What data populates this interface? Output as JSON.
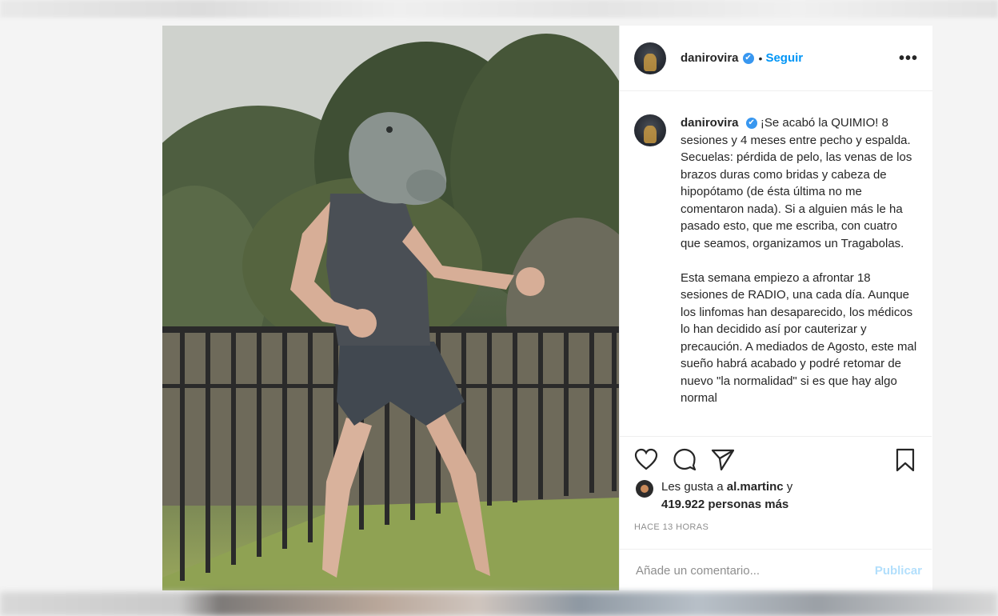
{
  "post": {
    "username": "danirovira",
    "verified_badge": "✔",
    "separator": "•",
    "follow_label": "Seguir",
    "more_label": "•••",
    "caption": "¡Se acabó la QUIMIO! 8 sesiones y 4 meses entre pecho y espalda. Secuelas: pérdida de pelo, las venas de los brazos duras como bridas y cabeza de hipopótamo (de ésta última no me comentaron nada). Si a alguien más le ha pasado esto, que me escriba, con cuatro que seamos, organizamos un Tragabolas.\n\nEsta semana empiezo a afrontar 18 sesiones de RADIO, una cada día. Aunque los linfomas han desaparecido, los médicos lo han decidido así por cauterizar y precaución. A mediados de Agosto, este mal sueño habrá acabado y podré retomar de nuevo \"la normalidad\" si es que hay algo normal",
    "likes_prefix": "Les gusta a ",
    "likes_user": "al.martinc",
    "likes_connector": " y",
    "likes_count": "419.922 personas más",
    "timestamp": "HACE 13 HORAS",
    "comment_placeholder": "Añade un comentario...",
    "publish_label": "Publicar"
  },
  "icons": {
    "like": "heart-icon",
    "comment": "comment-icon",
    "share": "send-icon",
    "save": "bookmark-icon"
  },
  "colors": {
    "link_blue": "#0095f6",
    "verified_blue": "#3897f0",
    "publish_disabled": "#b2dffc"
  }
}
